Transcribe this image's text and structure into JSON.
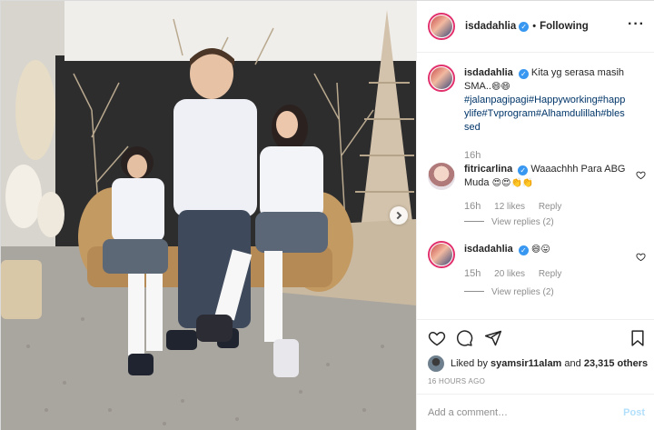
{
  "post": {
    "username": "isdadahlia",
    "follow_status": "Following",
    "more_icon": "more-horizontal-icon"
  },
  "caption": {
    "username": "isdadahlia",
    "text": "Kita yg serasa masih SMA..",
    "emojis": "😄😄",
    "hashtags": "#jalanpagipagi#Happyworking#happylife#Tvprogram#Alhamdulillah#blessed",
    "time": "16h"
  },
  "comments": [
    {
      "username": "fitricarlina",
      "text": "Waaachhh Para ABG Muda",
      "emojis": "😍😍👏👏",
      "time": "16h",
      "likes": "12 likes",
      "reply": "Reply",
      "view_replies": "View replies (2)"
    },
    {
      "username": "isdadahlia",
      "text": "",
      "emojis": "😄😛",
      "time": "15h",
      "likes": "20 likes",
      "reply": "Reply",
      "view_replies": "View replies (2)"
    }
  ],
  "likes_summary": {
    "prefix": "Liked by",
    "user": "syamsir11alam",
    "connector": "and",
    "count": "23,315 others"
  },
  "time_ago": "16 HOURS AGO",
  "add_comment": {
    "placeholder": "Add a comment…",
    "post_label": "Post"
  },
  "colors": {
    "verified": "#3897f0",
    "story_ring": "#e1306c",
    "hashtag": "#003569",
    "post_disabled": "#b2dffc"
  }
}
